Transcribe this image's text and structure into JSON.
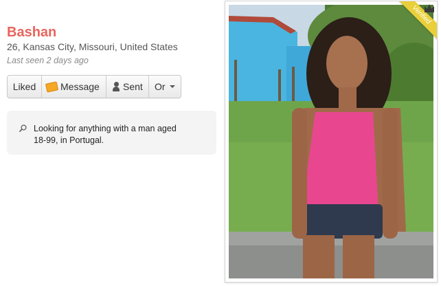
{
  "profile": {
    "name": "Bashan",
    "details": "26, Kansas City, Missouri, United States",
    "last_seen": "Last seen 2 days ago"
  },
  "actions": {
    "liked": "Liked",
    "message": "Message",
    "sent": "Sent",
    "or": "Or"
  },
  "looking_for": {
    "icon": "search-icon",
    "text": "Looking for anything with a man aged 18-99, in Portugal."
  },
  "photo": {
    "badge": "Verified",
    "badge_color": "#e9cf3a",
    "badge_icon": "crown-icon"
  },
  "colors": {
    "name": "#e8645c"
  }
}
